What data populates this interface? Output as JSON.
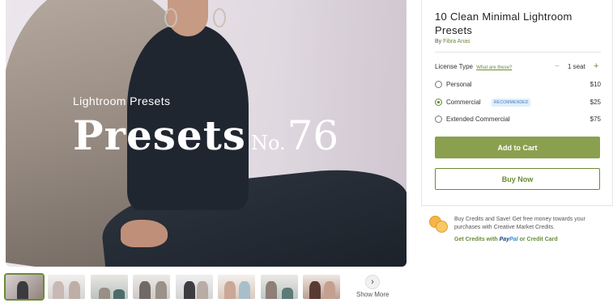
{
  "hero": {
    "subtitle": "Lightroom Presets",
    "title_main": "Presets",
    "title_no": "No.",
    "title_number": "76"
  },
  "thumbnails": {
    "count": 8,
    "active_index": 0,
    "show_more_icon": "chevron-right-icon",
    "show_more_label": "Show More"
  },
  "product": {
    "title": "10 Clean Minimal Lightroom Presets",
    "by_prefix": "By",
    "author": "Fibra Anas"
  },
  "license": {
    "label": "License Type",
    "help_link": "What are these?",
    "minus": "−",
    "seats": "1 seat",
    "plus": "+",
    "options": [
      {
        "name": "Personal",
        "price": "$10",
        "selected": false,
        "badge": ""
      },
      {
        "name": "Commercial",
        "price": "$25",
        "selected": true,
        "badge": "RECOMMENDED"
      },
      {
        "name": "Extended Commercial",
        "price": "$75",
        "selected": false,
        "badge": ""
      }
    ]
  },
  "actions": {
    "add_to_cart": "Add to Cart",
    "buy_now": "Buy Now"
  },
  "promo": {
    "text": "Buy Credits and Save! Get free money towards your purchases with Creative Market Credits.",
    "link_prefix": "Get Credits with",
    "paypal_a": "Pay",
    "paypal_b": "Pal",
    "link_suffix": "or Credit Card"
  },
  "colors": {
    "accent": "#8aa04f",
    "accent_dark": "#6a8b36",
    "badge_bg": "#e1eef9"
  }
}
